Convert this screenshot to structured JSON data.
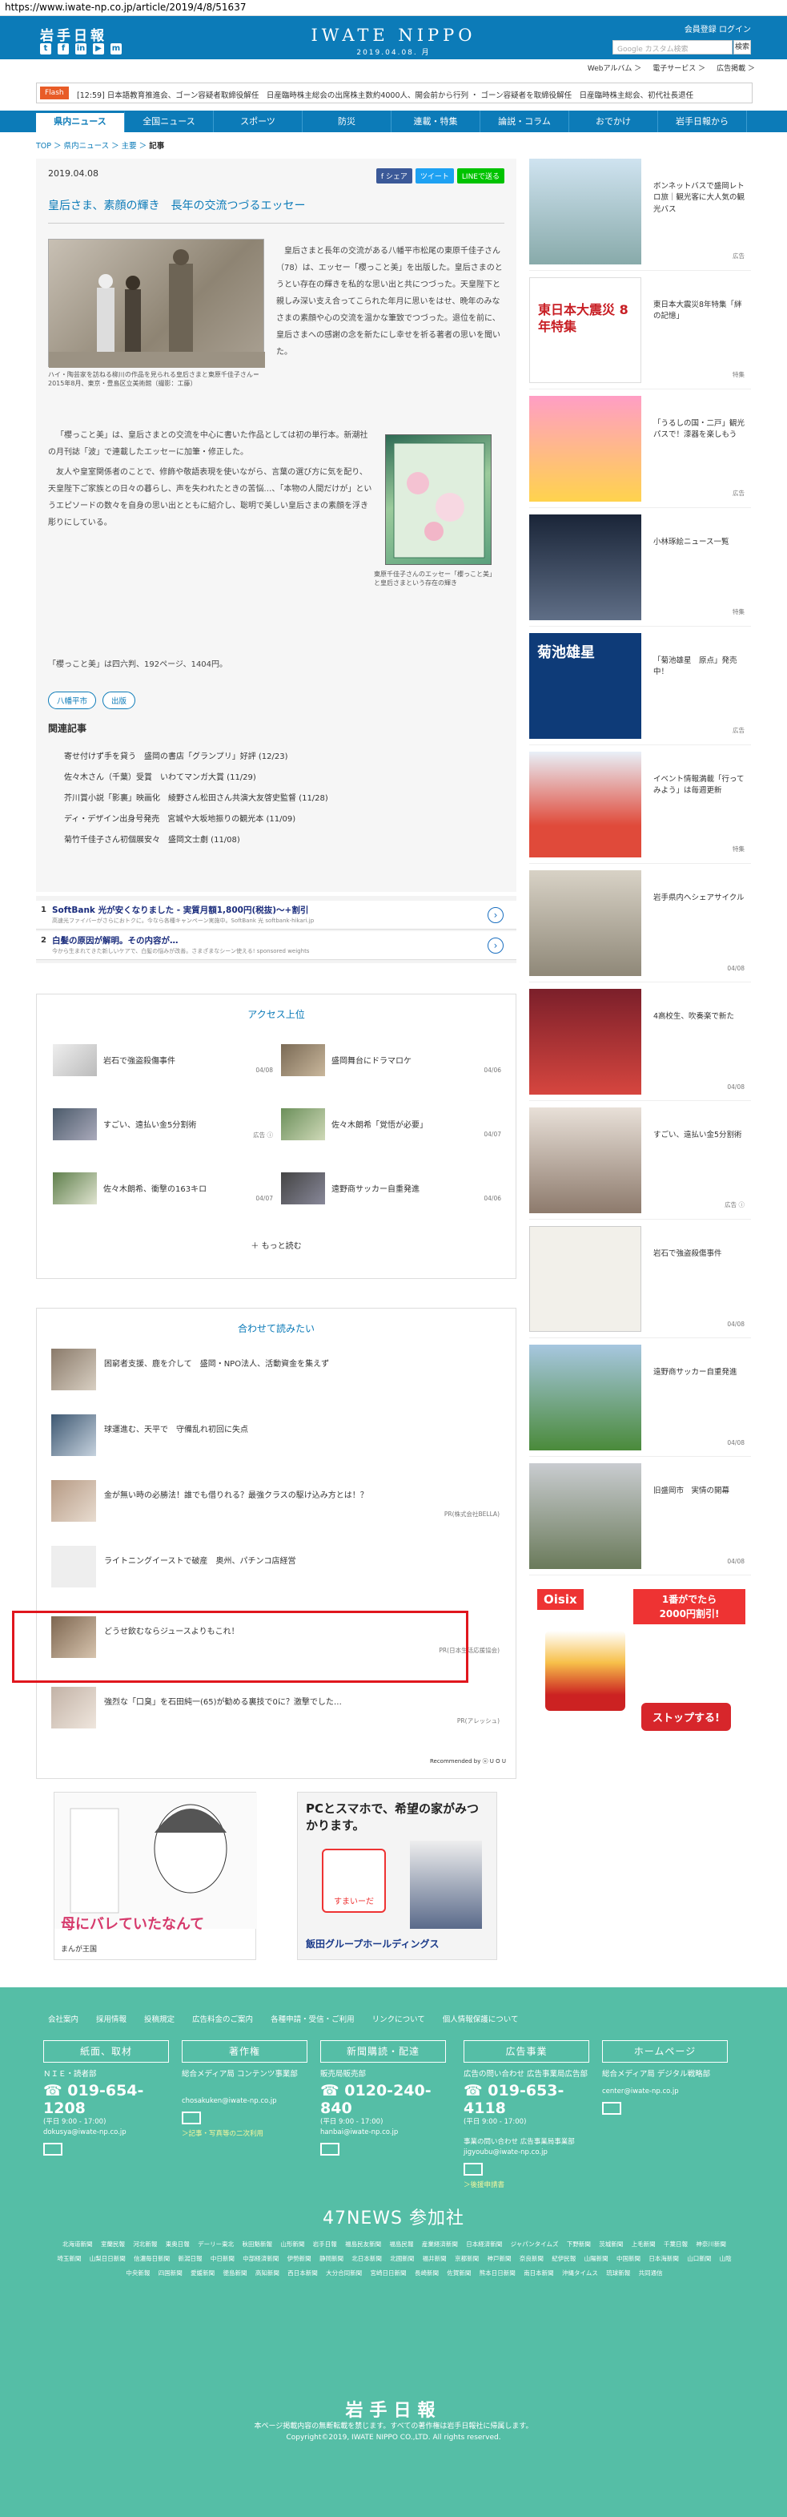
{
  "url": "https://www.iwate-np.co.jp/article/2019/4/8/51637",
  "header": {
    "logo": "岩手日報",
    "brand": "IWATE NIPPO",
    "date": "2019.04.08. 月",
    "links": "会員登録 ログイン",
    "search_placeholder": "Google カスタム検索",
    "search_btn": "検索",
    "social": [
      "t",
      "f",
      "in",
      "▶",
      "m"
    ]
  },
  "subnav": [
    "Webアルバム ＞",
    "電子サービス ＞",
    "広告掲載 ＞"
  ],
  "flash": {
    "tag": "Flash",
    "text": "[12:59] 日本語教育推進会、ゴーン容疑者取締役解任　日産臨時株主総会の出席株主数約4000人、開会前から行列 ・ ゴーン容疑者を取締役解任　日産臨時株主総会、初代社長退任"
  },
  "gnav": [
    "県内ニュース",
    "全国ニュース",
    "スポーツ",
    "防災",
    "連載・特集",
    "論説・コラム",
    "おでかけ",
    "岩手日報から"
  ],
  "breadcrumb": {
    "top": "TOP",
    "a": "県内ニュース",
    "b": "主要",
    "current": "記事"
  },
  "article": {
    "date": "2019.04.08",
    "share": [
      "f シェア",
      "ツイート",
      "LINEで送る"
    ],
    "title": "皇后さま、素顔の輝き　長年の交流つづるエッセー",
    "caption1": "ハイ・陶芸家を訪ねる柳川の作品を見られる皇后さまと東原千佳子さん＝2015年8月、東京・豊島区立美術館（撮影：工藤）",
    "body1": "皇后さまと長年の交流がある八幡平市松尾の東原千佳子さん（78）は、エッセー「櫻っこと美」を出版した。皇后さまのとうとい存在の輝きを私的な思い出と共につづった。天皇陛下と親しみ深い支え合ってこられた年月に思いをはせ、晩年のみなさまの素顔や心の交流を温かな筆致でつづった。退位を前に、皇后さまへの感謝の念を新たにし幸せを祈る著者の思いを聞いた。",
    "caption2": "東原千佳子さんのエッセー「櫻っこと美」と皇后さまという存在の輝き",
    "body2_p1": "「櫻っこと美」は、皇后さまとの交流を中心に書いた作品としては初の単行本。新潮社の月刊誌「波」で連載したエッセーに加筆・修正した。",
    "body2_p2": "友人や皇室関係者のことで、修飾や敬語表現を使いながら、言葉の選び方に気を配り、天皇陛下ご家族との日々の暮らし、声を失われたときの苦悩…、「本物の人間だけが」というエピソードの数々を自身の思い出とともに紹介し、聡明で美しい皇后さまの素顔を浮き彫りにしている。",
    "body3": "「櫻っこと美」は四六判、192ページ、1404円。",
    "tags": [
      "八幡平市",
      "出版"
    ],
    "related_heading": "関連記事",
    "related": [
      "寄せ付けず手を貸う　盛岡の書店「グランプリ」好評 (12/23)",
      "佐々木さん（千葉）受賞　いわてマンガ大賞 (11/29)",
      "芥川賞小説「影裏」映画化　綾野さん松田さん共演大友啓史監督 (11/28)",
      "ディ・デザイン出身号発売　宮城や大坂地振りの観光本 (11/09)",
      "菊竹千佳子さん初個展安々　盛岡文士劇 (11/08)"
    ]
  },
  "ads": [
    {
      "num": "1",
      "title": "SoftBank 光が安くなりました - 実質月額1,800円(税抜)〜+割引",
      "sub": "高速光ファイバーがさらにおトクに。今なら各種キャンペーン実施中。SoftBank 光 softbank-hikari.jp"
    },
    {
      "num": "2",
      "title": "白髪の原因が解明。その内容が…",
      "sub": "今から生まれてきた新しいケアで、白髪の悩みが改善。さまざまなシーン使える! sponsored weights"
    }
  ],
  "access": {
    "title": "アクセス上位",
    "items": [
      {
        "text": "岩石で強盗殺傷事件",
        "date": "04/08"
      },
      {
        "text": "盛岡舞台にドラマロケ",
        "date": "04/06"
      },
      {
        "text": "すごい、遠払い金5分割術",
        "date": "広告 ⓘ"
      },
      {
        "text": "佐々木朗希「覚悟が必要」",
        "date": "04/07"
      },
      {
        "text": "佐々木朗希、衝撃の163キロ",
        "date": "04/07"
      },
      {
        "text": "遠野商サッカー自重発進",
        "date": "04/06"
      }
    ],
    "more": "もっと読む"
  },
  "recommend": {
    "title": "合わせて読みたい",
    "items": [
      {
        "text": "困窮者支援、鹿を介して　盛岡・NPO法人、活動資金を集えず",
        "pr": ""
      },
      {
        "text": "球運進む、天平で　守備乱れ初回に失点",
        "pr": ""
      },
      {
        "text": "金が無い時の必勝法！誰でも借りれる？最強クラスの駆け込み方とは！？",
        "pr": "PR(株式会社BELLA)"
      },
      {
        "text": "ライトニングイーストで破産　奥州、パチンコ店経営",
        "pr": ""
      },
      {
        "text": "どうせ飲むならジュースよりもこれ！",
        "pr": "PR(日本生活応援協会)"
      },
      {
        "text": "強烈な「口臭」を石田純一(65)が勧める裏技で0に？激撃でした…",
        "pr": "PR(アレッシュ)"
      }
    ],
    "credit": "Recommended by ⓤ U O U"
  },
  "banner1": {
    "text": "母にバレていたなんて",
    "brand": "まんが王国"
  },
  "banner2": {
    "headline": "PCとスマホで、希望の家がみつかります。",
    "brand": "飯田グループホールディングス",
    "tag": "すまいーだ"
  },
  "sidebar": [
    {
      "text": "ボンネットバスで盛岡レトロ旅｜観光客に大人気の観光バス",
      "tag": "広告"
    },
    {
      "text": "東日本大震災8年特集「絆の記憶」",
      "tag": "特集",
      "thumb_text": "東日本大震災 8年特集"
    },
    {
      "text": "「うるしの国・二戸」観光パスで！漆器を楽しもう",
      "tag": "広告"
    },
    {
      "text": "小林琢絵ニュース一覧",
      "tag": "特集"
    },
    {
      "text": "「菊池雄星　原点」発売中！",
      "tag": "広告",
      "thumb_text": "菊池雄星"
    },
    {
      "text": "イベント情報満載「行ってみよう」は毎週更新",
      "tag": "特集"
    },
    {
      "text": "岩手県内へシェアサイクル",
      "tag": "04/08"
    },
    {
      "text": "4高校生、吹奏楽で新た",
      "tag": "04/08"
    },
    {
      "text": "すごい、遠払い金5分割術",
      "tag": "広告 ⓘ"
    },
    {
      "text": "岩石で強盗殺傷事件",
      "tag": "04/08"
    },
    {
      "text": "遠野商サッカー自重発進",
      "tag": "04/08"
    },
    {
      "text": "旧盛岡市　実情の開幕",
      "tag": "04/08"
    }
  ],
  "side_ad": {
    "brand": "Oisix",
    "line1": "1番がでたら",
    "line2": "2000円割引!",
    "cta": "ストップする!"
  },
  "footer": {
    "links": [
      "会社案内",
      "採用情報",
      "投稿規定",
      "広告料金のご案内",
      "各種申請・受信・ご利用",
      "リンクについて",
      "個人情報保護について"
    ],
    "cols": [
      {
        "h": "紙面、取材",
        "sub": "ＮＩＥ・読者部",
        "tel": "019-654-1208",
        "hours": "(平日 9:00 - 17:00)",
        "mail": "dokusya@iwate-np.co.jp",
        "link": ""
      },
      {
        "h": "著作権",
        "sub": "総合メディア局 コンテンツ事業部",
        "tel": "",
        "hours": "",
        "mail": "chosakuken@iwate-np.co.jp",
        "link": "＞記事・写真等の二次利用"
      },
      {
        "h": "新聞購読・配達",
        "sub": "販売局販売部",
        "tel": "0120-240-840",
        "hours": "(平日 9:00 - 17:00)",
        "mail": "hanbai@iwate-np.co.jp",
        "link": ""
      },
      {
        "h": "広告事業",
        "sub": "広告の問い合わせ 広告事業局広告部",
        "tel": "019-653-4118",
        "hours": "(平日 9:00 - 17:00)",
        "mail": "事業の問い合わせ 広告事業局事業部 jigyoubu@iwate-np.co.jp",
        "link": "＞後援申請書"
      },
      {
        "h": "ホームページ",
        "sub": "総合メディア局 デジタル戦略部",
        "tel": "",
        "hours": "",
        "mail": "center@iwate-np.co.jp",
        "link": ""
      }
    ],
    "news47": "47NEWS 参加社",
    "papers": "北海道新聞 室蘭民報 河北新報 東奥日報 デーリー東北 秋田魁新報 山形新聞 岩手日報 福島民友新聞 福島民報 産業経済新聞 日本経済新聞 ジャパンタイムズ 下野新聞 茨城新聞 上毛新聞 千葉日報 神奈川新聞 埼玉新聞 山梨日日新聞 信濃毎日新聞 新潟日報 中日新聞 中部経済新聞 伊勢新聞 静岡新聞 北日本新聞 北國新聞 福井新聞 京都新聞 神戸新聞 奈良新聞 紀伊民報 山陽新聞 中国新聞 日本海新聞 山口新聞 山陰中央新報 四国新聞 愛媛新聞 徳島新聞 高知新聞 西日本新聞 大分合同新聞 宮崎日日新聞 長崎新聞 佐賀新聞 熊本日日新聞 南日本新聞 沖縄タイムス 琉球新報 共同通信",
    "logo": "岩手日報",
    "notice": "本ページ掲載内容の無断転載を禁じます。すべての著作権は岩手日報社に帰属します。",
    "copyright": "Copyright©2019, IWATE NIPPO CO.,LTD. All rights reserved."
  },
  "colors": {
    "brand_blue": "#0c7bb8",
    "footer_green": "#55bea6",
    "flash": "#e85c27",
    "highlight": "#e0161d"
  }
}
